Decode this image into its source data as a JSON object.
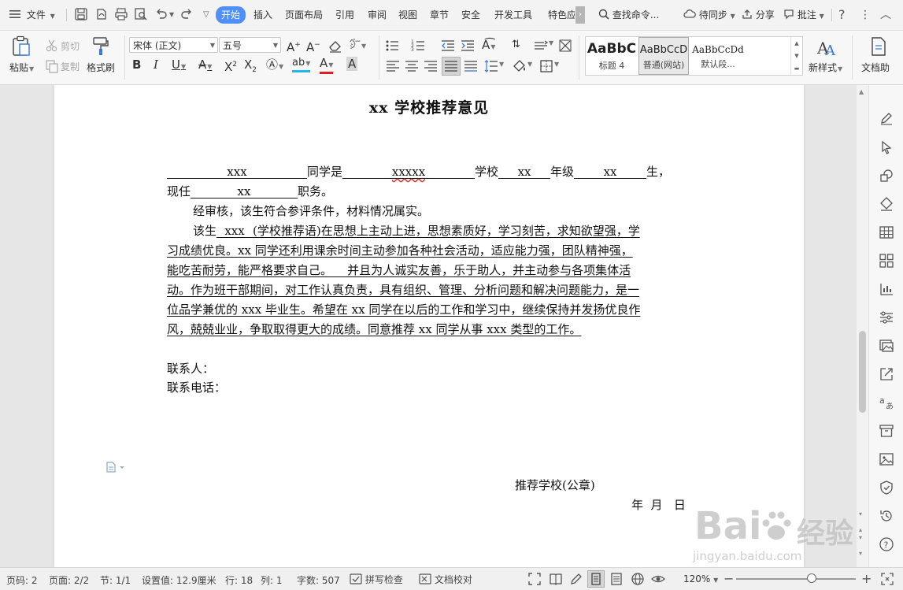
{
  "menubar": {
    "file_label": "文件",
    "tabs": [
      "开始",
      "插入",
      "页面布局",
      "引用",
      "审阅",
      "视图",
      "章节",
      "安全",
      "开发工具",
      "特色应"
    ],
    "active_tab": "开始",
    "search_label": "查找命令...",
    "sync_label": "待同步",
    "share_label": "分享",
    "comment_label": "批注"
  },
  "ribbon": {
    "paste_label": "粘贴",
    "cut_label": "剪切",
    "copy_label": "复制",
    "format_painter_label": "格式刷",
    "font_name": "宋体 (正文)",
    "font_size": "五号",
    "styles": [
      {
        "preview": "AaBbC",
        "label": "标题 4"
      },
      {
        "preview": "AaBbCcD",
        "label": "普通(网站)"
      },
      {
        "preview": "AaBbCcDd",
        "label": "默认段..."
      }
    ],
    "new_style_label": "新样式",
    "doc_helper_label": "文档助"
  },
  "document": {
    "title": "xx 学校推荐意见",
    "line1": {
      "name": "xxx",
      "t1": "同学是",
      "school": "xxxxx",
      "t2": "学校",
      "grade": "xx",
      "t3": "年级",
      "cls": "xx",
      "t4": "生，"
    },
    "line2": {
      "t1": "现任",
      "post": "xx",
      "t2": "职务。"
    },
    "line3": "经审核，该生符合参评条件，材料情况属实。",
    "para": {
      "l1_pre": "该生",
      "l1_name": "xxx",
      "l1_rest": "(学校推荐语)在思想上主动上进，思想素质好，学习刻苦，求知欲望强，学",
      "l2": "习成绩优良。xx 同学还利用课余时间主动参加各种社会活动，适应能力强，团队精神强，",
      "l3": "能吃苦耐劳，能严格要求自己。    并且为人诚实友善，乐于助人，并主动参与各项集体活",
      "l4": "动。作为班干部期间，对工作认真负责，具有组织、管理、分析问题和解决问题能力，是一",
      "l5": "位品学兼优的 xxx 毕业生。希望在 xx 同学在以后的工作和学习中，继续保持并发扬优良作",
      "l6": "风，兢兢业业，争取取得更大的成绩。同意推荐 xx 同学从事 xxx 类型的工作。"
    },
    "contact": "联系人：",
    "phone": "联系电话：",
    "school_seal": "推荐学校(公章)",
    "date": "年  月   日"
  },
  "status": {
    "page_no": "页码: 2",
    "pages": "页面: 2/2",
    "section": "节: 1/1",
    "setting": "设置值: 12.9厘米",
    "row": "行: 18",
    "col": "列: 1",
    "words": "字数: 507",
    "spell": "拼写检查",
    "proof": "文档校对",
    "zoom": "120%",
    "zoom_level": 0.63
  },
  "watermark": {
    "brand": "Bai",
    "brand2": "经验",
    "url": "jingyan.baidu.com"
  }
}
